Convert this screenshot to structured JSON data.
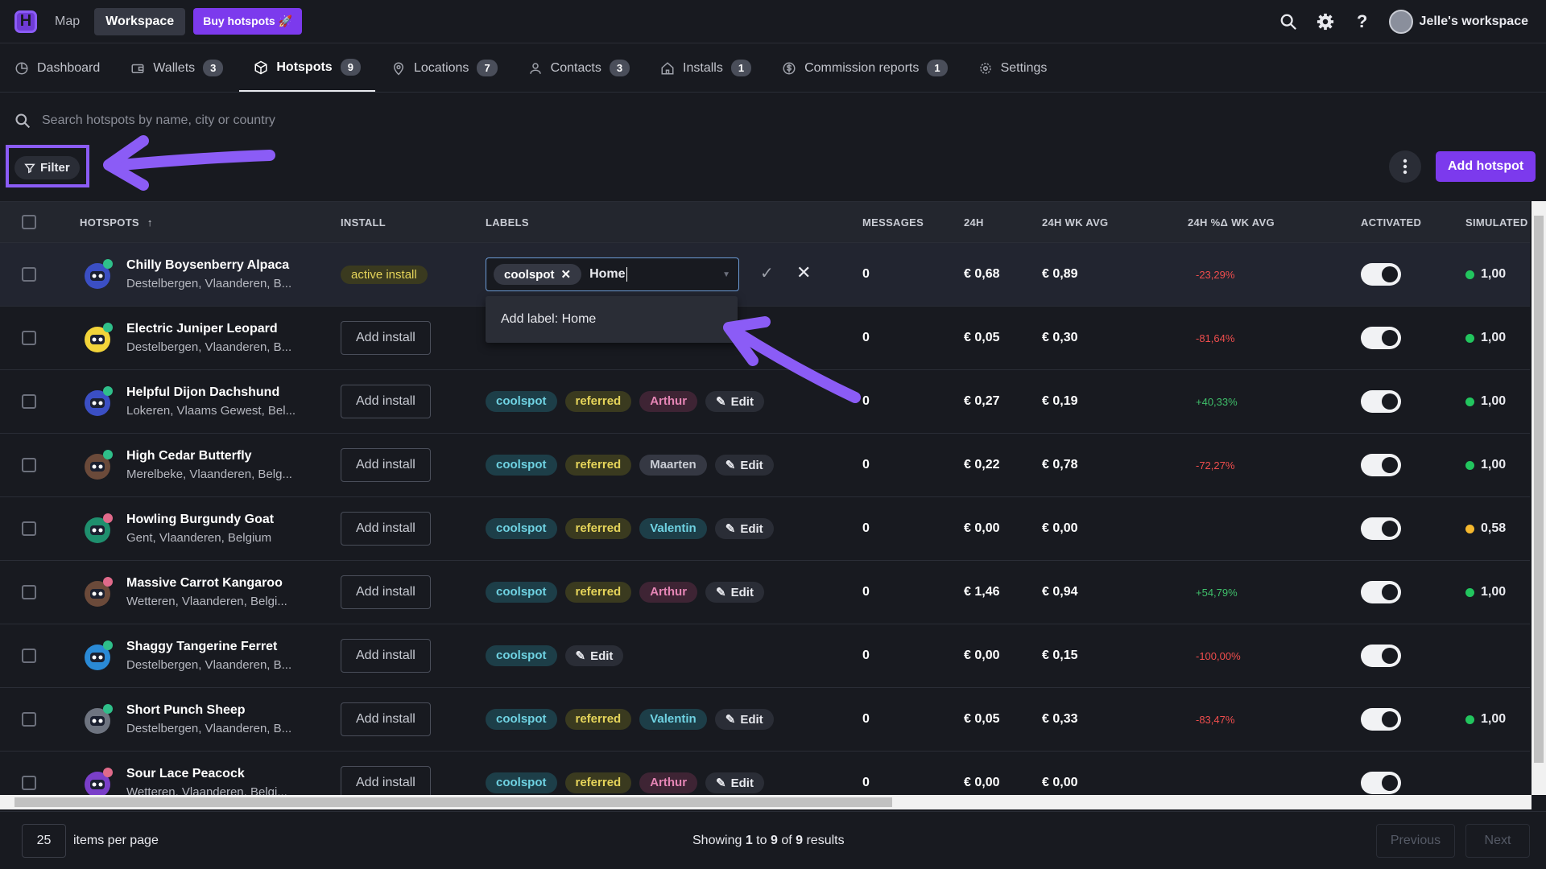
{
  "topbar": {
    "logo": "H",
    "map_label": "Map",
    "workspace_label": "Workspace",
    "buy_label": "Buy hotspots",
    "user_name": "Jelle's workspace"
  },
  "tabs": [
    {
      "label": "Dashboard",
      "badge": null
    },
    {
      "label": "Wallets",
      "badge": "3"
    },
    {
      "label": "Hotspots",
      "badge": "9"
    },
    {
      "label": "Locations",
      "badge": "7"
    },
    {
      "label": "Contacts",
      "badge": "3"
    },
    {
      "label": "Installs",
      "badge": "1"
    },
    {
      "label": "Commission reports",
      "badge": "1"
    },
    {
      "label": "Settings",
      "badge": null
    }
  ],
  "search": {
    "placeholder": "Search hotspots by name, city or country"
  },
  "filter_label": "Filter",
  "add_hotspot_label": "Add hotspot",
  "columns": [
    "HOTSPOTS",
    "INSTALL",
    "LABELS",
    "MESSAGES",
    "24H",
    "24H WK AVG",
    "24H %Δ WK AVG",
    "ACTIVATED",
    "SIMULATED"
  ],
  "label_editor": {
    "chip": "coolspot",
    "input_value": "Home",
    "dropdown_option": "Add label: Home"
  },
  "rows": [
    {
      "name": "Chilly Boysenberry Alpaca",
      "location": "Destelbergen, Vlaanderen, B...",
      "install": "active install",
      "labels": [],
      "messages": "0",
      "h24": "€ 0,68",
      "wk_avg": "€ 0,89",
      "pct": "-23,29%",
      "pct_sign": "neg",
      "simulated": "1,00",
      "sim_color": "#22c55e",
      "avatar_color": "#3b4fc4"
    },
    {
      "name": "Electric Juniper Leopard",
      "location": "Destelbergen, Vlaanderen, B...",
      "install": "Add install",
      "labels": [],
      "messages": "0",
      "h24": "€ 0,05",
      "wk_avg": "€ 0,30",
      "pct": "-81,64%",
      "pct_sign": "neg",
      "simulated": "1,00",
      "sim_color": "#22c55e",
      "avatar_color": "#f2d43a"
    },
    {
      "name": "Helpful Dijon Dachshund",
      "location": "Lokeren, Vlaams Gewest, Bel...",
      "install": "Add install",
      "labels": [
        {
          "text": "coolspot",
          "style": "teal"
        },
        {
          "text": "referred",
          "style": "yellow"
        },
        {
          "text": "Arthur",
          "style": "pink"
        }
      ],
      "messages": "0",
      "h24": "€ 0,27",
      "wk_avg": "€ 0,19",
      "pct": "+40,33%",
      "pct_sign": "pos",
      "simulated": "1,00",
      "sim_color": "#22c55e",
      "avatar_color": "#3b4fc4"
    },
    {
      "name": "High Cedar Butterfly",
      "location": "Merelbeke, Vlaanderen, Belg...",
      "install": "Add install",
      "labels": [
        {
          "text": "coolspot",
          "style": "teal"
        },
        {
          "text": "referred",
          "style": "yellow"
        },
        {
          "text": "Maarten",
          "style": "gray"
        }
      ],
      "messages": "0",
      "h24": "€ 0,22",
      "wk_avg": "€ 0,78",
      "pct": "-72,27%",
      "pct_sign": "neg",
      "simulated": "1,00",
      "sim_color": "#22c55e",
      "avatar_color": "#6b4a3a"
    },
    {
      "name": "Howling Burgundy Goat",
      "location": "Gent, Vlaanderen, Belgium",
      "install": "Add install",
      "labels": [
        {
          "text": "coolspot",
          "style": "teal"
        },
        {
          "text": "referred",
          "style": "yellow"
        },
        {
          "text": "Valentin",
          "style": "teal"
        }
      ],
      "messages": "0",
      "h24": "€ 0,00",
      "wk_avg": "€ 0,00",
      "pct": "",
      "pct_sign": "neg",
      "simulated": "0,58",
      "sim_color": "#f5b82e",
      "avatar_color": "#1f8f6e"
    },
    {
      "name": "Massive Carrot Kangaroo",
      "location": "Wetteren, Vlaanderen, Belgi...",
      "install": "Add install",
      "labels": [
        {
          "text": "coolspot",
          "style": "teal"
        },
        {
          "text": "referred",
          "style": "yellow"
        },
        {
          "text": "Arthur",
          "style": "pink"
        }
      ],
      "messages": "0",
      "h24": "€ 1,46",
      "wk_avg": "€ 0,94",
      "pct": "+54,79%",
      "pct_sign": "pos",
      "simulated": "1,00",
      "sim_color": "#22c55e",
      "avatar_color": "#6b4a3a"
    },
    {
      "name": "Shaggy Tangerine Ferret",
      "location": "Destelbergen, Vlaanderen, B...",
      "install": "Add install",
      "labels": [
        {
          "text": "coolspot",
          "style": "teal"
        }
      ],
      "messages": "0",
      "h24": "€ 0,00",
      "wk_avg": "€ 0,15",
      "pct": "-100,00%",
      "pct_sign": "neg",
      "simulated": "",
      "sim_color": "",
      "avatar_color": "#2a8ad6"
    },
    {
      "name": "Short Punch Sheep",
      "location": "Destelbergen, Vlaanderen, B...",
      "install": "Add install",
      "labels": [
        {
          "text": "coolspot",
          "style": "teal"
        },
        {
          "text": "referred",
          "style": "yellow"
        },
        {
          "text": "Valentin",
          "style": "teal"
        }
      ],
      "messages": "0",
      "h24": "€ 0,05",
      "wk_avg": "€ 0,33",
      "pct": "-83,47%",
      "pct_sign": "neg",
      "simulated": "1,00",
      "sim_color": "#22c55e",
      "avatar_color": "#6e7480"
    },
    {
      "name": "Sour Lace Peacock",
      "location": "Wetteren, Vlaanderen, Belgi...",
      "install": "Add install",
      "labels": [
        {
          "text": "coolspot",
          "style": "teal"
        },
        {
          "text": "referred",
          "style": "yellow"
        },
        {
          "text": "Arthur",
          "style": "pink"
        }
      ],
      "messages": "0",
      "h24": "€ 0,00",
      "wk_avg": "€ 0,00",
      "pct": "",
      "pct_sign": "neg",
      "simulated": "",
      "sim_color": "",
      "avatar_color": "#7a3fc9"
    }
  ],
  "edit_label": "Edit",
  "footer": {
    "per_page": "25",
    "per_page_label": "items per page",
    "showing_pre": "Showing ",
    "from": "1",
    "to_word": " to ",
    "to": "9",
    "of_word": " of ",
    "total": "9",
    "results_word": " results",
    "previous": "Previous",
    "next": "Next"
  },
  "colors": {
    "accent": "#7c3aed",
    "arrow": "#8b5cf6"
  }
}
